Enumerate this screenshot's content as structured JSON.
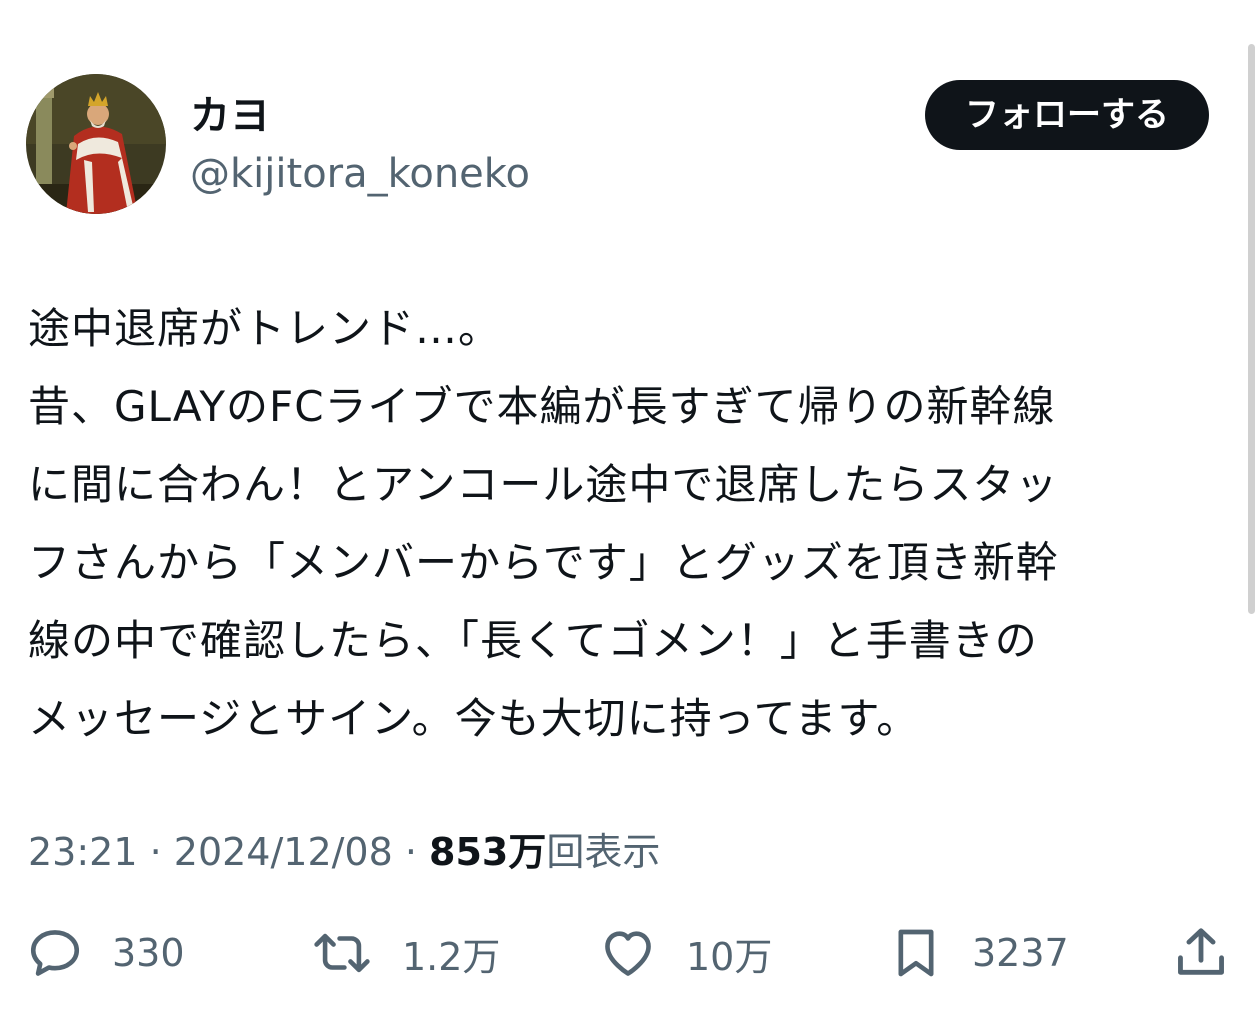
{
  "author": {
    "display_name": "カヨ",
    "handle": "@kijitora_koneko",
    "avatar_icon": "king-portrait-avatar"
  },
  "follow_button": {
    "label": "フォローする"
  },
  "tweet": {
    "lines": [
      "途中退席がトレンド…。",
      "昔、GLAYのFCライブで本編が長すぎて帰りの新幹線",
      "に間に合わん！とアンコール途中で退席したらスタッ",
      "フさんから「メンバーからです」とグッズを頂き新幹",
      "線の中で確認したら、「長くてゴメン！」と手書きの",
      "メッセージとサイン。今も大切に持ってます。"
    ]
  },
  "meta": {
    "time": "23:21",
    "separator": " · ",
    "date": "2024/12/08",
    "views_count": "853万",
    "views_label": "回表示"
  },
  "actions": {
    "reply_count": "330",
    "repost_count": "1.2万",
    "like_count": "10万",
    "bookmark_count": "3237"
  },
  "colors": {
    "text_primary": "#0f1419",
    "text_secondary": "#536471",
    "button_bg": "#0f1419",
    "icon": "#536471"
  }
}
